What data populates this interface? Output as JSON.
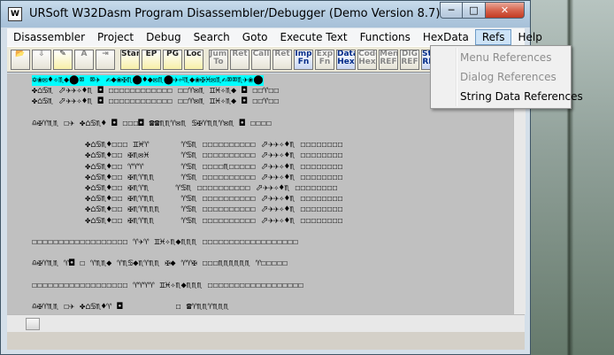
{
  "window": {
    "title": "URSoft W32Dasm Program Disassembler/Debugger (Demo Version 8.7)",
    "app_icon_glyph": "W",
    "controls": {
      "minimize": "─",
      "maximize": "□",
      "close": "✕"
    }
  },
  "menubar": {
    "items": [
      {
        "label": "Disassembler"
      },
      {
        "label": "Project"
      },
      {
        "label": "Debug"
      },
      {
        "label": "Search"
      },
      {
        "label": "Goto"
      },
      {
        "label": "Execute Text"
      },
      {
        "label": "Functions"
      },
      {
        "label": "HexData"
      },
      {
        "label": "Refs",
        "active": true
      },
      {
        "label": "Help"
      }
    ]
  },
  "toolbar": {
    "buttons": [
      {
        "name": "open-file-icon",
        "mark": "📂",
        "style": ""
      },
      {
        "name": "save-icon",
        "mark": "⇩",
        "style": "gray"
      },
      {
        "name": "print-icon",
        "mark": "✎",
        "style": "yellow"
      },
      {
        "name": "font-icon",
        "mark": "A",
        "style": "gray"
      },
      {
        "name": "goto-code-icon",
        "mark": "⇥",
        "style": "gray"
      },
      {
        "name": "goto-start-icon",
        "mark": "Start",
        "style": "yellow"
      },
      {
        "name": "goto-ep-icon",
        "mark": "EP",
        "style": "yellow"
      },
      {
        "name": "goto-page-icon",
        "mark": "PG",
        "style": "yellow"
      },
      {
        "name": "goto-location-icon",
        "mark": "Loc",
        "style": "yellow"
      },
      {
        "name": "jump-to-icon",
        "mark": "Jump To",
        "style": "gray"
      },
      {
        "name": "ret-icon",
        "mark": "Ret",
        "style": "gray"
      },
      {
        "name": "call-icon",
        "mark": "Call",
        "style": "gray"
      },
      {
        "name": "ret-back-icon",
        "mark": "Ret",
        "style": "gray"
      },
      {
        "name": "imp-fn-icon",
        "mark": "Imp Fn",
        "style": "blue"
      },
      {
        "name": "exp-fn-icon",
        "mark": "Exp Fn",
        "style": "gray"
      },
      {
        "name": "data-hex-icon",
        "mark": "Data Hex",
        "style": "blue"
      },
      {
        "name": "code-hex-icon",
        "mark": "Code Hex",
        "style": "gray"
      },
      {
        "name": "menu-ref-icon",
        "mark": "Menu REF",
        "style": "gray"
      },
      {
        "name": "dlg-ref-icon",
        "mark": "DlG REF",
        "style": "gray"
      },
      {
        "name": "strn-ref-icon",
        "mark": "Strn REF",
        "style": "blue"
      }
    ]
  },
  "code": {
    "lines": [
      {
        "text": "✡❀✉♦✧♏◆⬤⌧ ⌧✈ ✍◆❀✠♏⬤♦◆✉♏⬤✈⏎♏◆❀✠♓✉♏✍⌧⌧♏✈❀⬤",
        "sel": true
      },
      {
        "text": "✤⌂♋♏ ⬀✈✈✧♦♏ ◘ ☐☐☐☐☐☐☐☐☐☐☐☐ ☐☐♈✉♏ ♊♓✧♏◆ ◘ ☐☐♈☐☐",
        "sel": false
      },
      {
        "text": "✤⌂♋♏ ⬀✈✈✧♦♏ ◘ ☐☐☐☐☐☐☐☐☐☐☐☐ ☐☐♈✉♏ ♊♓✧♏◆ ◘ ☐☐♈☐☐",
        "sel": false
      },
      {
        "text": "",
        "sel": false
      },
      {
        "text": "♎✠♈♏♏ ☐✈ ✤⌂♋♏♦ ◘ ☐☐☐◘ ☎☎♏♏♈✉♏ ♋✠♈♏♏♈✉♏ ◘ ☐☐☐☐",
        "sel": false
      },
      {
        "text": "",
        "sel": false
      },
      {
        "text": "          ✤⌂♋♏♦☐☐☐ ♊♓♈      ♈♋♏ ☐☐☐☐☐☐☐☐☐☐ ⬀✈✈✧♦♏ ☐☐☐☐☐☐☐☐",
        "sel": false
      },
      {
        "text": "          ✤⌂♋♏♦☐☐ ✠♏✉♓      ♈♋♏ ☐☐☐☐☐☐☐☐☐☐ ⬀✈✈✧♦♏ ☐☐☐☐☐☐☐☐",
        "sel": false
      },
      {
        "text": "          ✤⌂♋♏♦☐☐ ♈♈♈       ♈♋♏ ☐☐☐☐♏☐☐☐☐☐ ⬀✈✈✧♦♏ ☐☐☐☐☐☐☐☐",
        "sel": false
      },
      {
        "text": "          ✤⌂♋♏♦☐☐ ✠♏♈♏♏     ♈♋♏ ☐☐☐☐☐☐☐☐☐☐ ⬀✈✈✧♦♏ ☐☐☐☐☐☐☐☐",
        "sel": false
      },
      {
        "text": "          ✤⌂♋♏♦☐☐ ✠♏♈♏     ♈♋♏ ☐☐☐☐☐☐☐☐☐☐ ⬀✈✈✧♦♏ ☐☐☐☐☐☐☐☐",
        "sel": false
      },
      {
        "text": "          ✤⌂♋♏♦☐☐ ✠♏♈♏♏     ♈♋♏ ☐☐☐☐☐☐☐☐☐☐ ⬀✈✈✧♦♏ ☐☐☐☐☐☐☐☐",
        "sel": false
      },
      {
        "text": "          ✤⌂♋♏♦☐☐ ✠♏♈♏♏♏    ♈♋♏ ☐☐☐☐☐☐☐☐☐☐ ⬀✈✈✧♦♏ ☐☐☐☐☐☐☐☐",
        "sel": false
      },
      {
        "text": "          ✤⌂♋♏♦☐☐ ✠♏♈♏♏     ♈♋♏ ☐☐☐☐☐☐☐☐☐☐ ⬀✈✈✧♦♏ ☐☐☐☐☐☐☐☐",
        "sel": false
      },
      {
        "text": "",
        "sel": false
      },
      {
        "text": "☐☐☐☐☐☐☐☐☐☐☐☐☐☐☐☐☐☐ ♈✈♈ ♊♓✧♏◆♏♏♏ ☐☐☐☐☐☐☐☐☐☐☐☐☐☐☐☐☐☐",
        "sel": false
      },
      {
        "text": "",
        "sel": false
      },
      {
        "text": "♎✠♈♏♏ ♈◘ ☐ ♈♏♏◆ ♈♏♋◆♏♈♏♏ ✠◆ ♈♈✠ ☐☐☐♏♏♏♏♏♏ ♈☐☐☐☐☐",
        "sel": false
      },
      {
        "text": "",
        "sel": false
      },
      {
        "text": "☐☐☐☐☐☐☐☐☐☐☐☐☐☐☐☐☐☐ ♈♈♈♈ ♊♓✧♏◆♏♏♏ ☐☐☐☐☐☐☐☐☐☐☐☐☐☐☐☐☐☐",
        "sel": false
      },
      {
        "text": "",
        "sel": false
      },
      {
        "text": "♎✠♈♏♏ ☐✈ ✤⌂♋♏♦♈ ◘          ☐ ☎♈♏♏♈♏♏♏",
        "sel": false
      }
    ]
  },
  "refs_menu": {
    "items": [
      {
        "label": "Menu References",
        "enabled": false
      },
      {
        "label": "Dialog References",
        "enabled": false
      },
      {
        "label": "String Data References",
        "enabled": true
      }
    ]
  }
}
